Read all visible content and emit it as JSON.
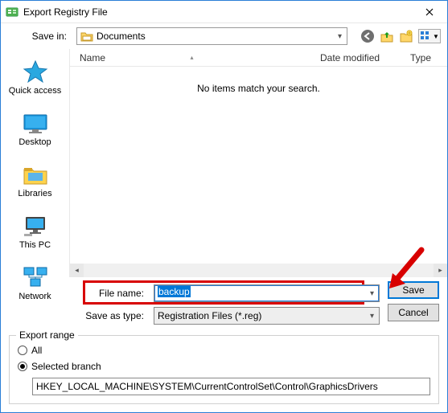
{
  "title": "Export Registry File",
  "toolbar": {
    "save_in_label": "Save in:",
    "location": "Documents",
    "icons": [
      "back",
      "up",
      "new-folder",
      "view-menu"
    ]
  },
  "places": [
    {
      "id": "quick-access",
      "label": "Quick access"
    },
    {
      "id": "desktop",
      "label": "Desktop"
    },
    {
      "id": "libraries",
      "label": "Libraries"
    },
    {
      "id": "this-pc",
      "label": "This PC"
    },
    {
      "id": "network",
      "label": "Network"
    }
  ],
  "columns": {
    "name": "Name",
    "date": "Date modified",
    "type": "Type"
  },
  "empty_message": "No items match your search.",
  "form": {
    "filename_label": "File name:",
    "filename_value": "backup",
    "type_label": "Save as type:",
    "type_value": "Registration Files (*.reg)",
    "save_btn": "Save",
    "cancel_btn": "Cancel"
  },
  "export_range": {
    "legend": "Export range",
    "all_label": "All",
    "selected_label": "Selected branch",
    "selected_checked": true,
    "branch_path": "HKEY_LOCAL_MACHINE\\SYSTEM\\CurrentControlSet\\Control\\GraphicsDrivers"
  }
}
